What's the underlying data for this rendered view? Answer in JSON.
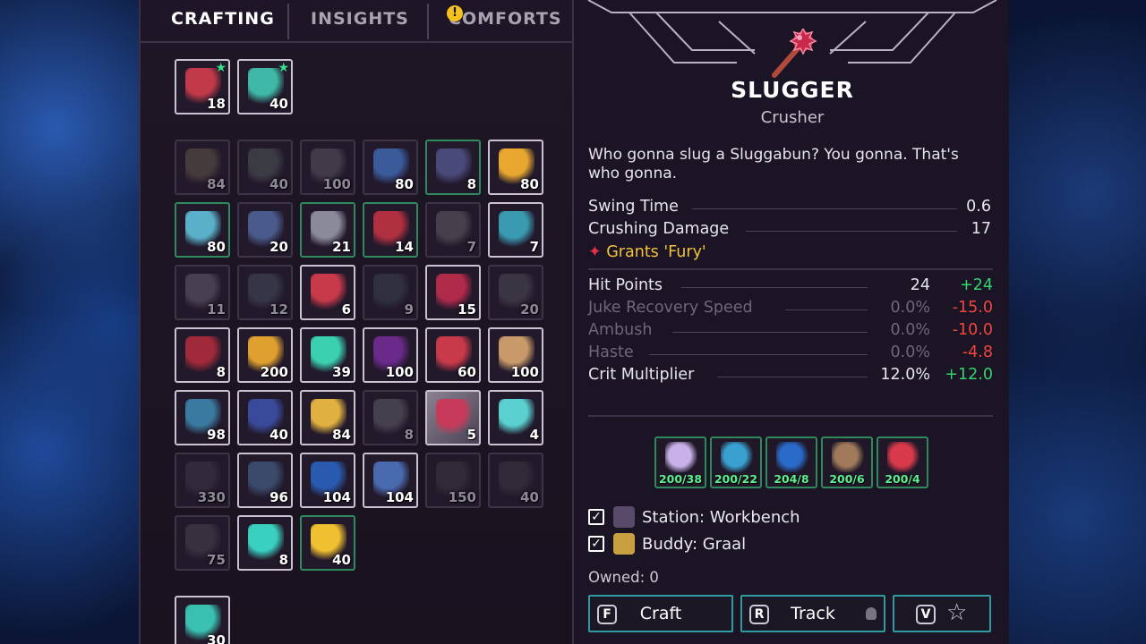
{
  "tabs": [
    {
      "label": "CRAFTING",
      "active": true
    },
    {
      "label": "INSIGHTS",
      "active": false
    },
    {
      "label": "COMFORTS",
      "active": false,
      "alert": "!"
    }
  ],
  "favorites": [
    {
      "icon": "horned-mask-icon",
      "count": "18",
      "color": "#c23a4a"
    },
    {
      "icon": "wrapped-cloth-icon",
      "count": "40",
      "color": "#3fb8a8"
    }
  ],
  "inventory": [
    {
      "icon": "stone-block-icon",
      "count": "84",
      "color": "#8a7a5a",
      "dim": true
    },
    {
      "icon": "rocks-icon",
      "count": "40",
      "color": "#6a7a74",
      "dim": true
    },
    {
      "icon": "slate-icon",
      "count": "100",
      "color": "#7a7880",
      "dim": true
    },
    {
      "icon": "feathers-icon",
      "count": "80",
      "color": "#3a5a9a"
    },
    {
      "icon": "metal-plate-icon",
      "count": "8",
      "color": "#4a4a7a",
      "border": "green"
    },
    {
      "icon": "honey-jar-icon",
      "count": "80",
      "color": "#e8a830",
      "border": "lit"
    },
    {
      "icon": "potion-bottle-icon",
      "count": "80",
      "color": "#5ab0c8",
      "border": "green"
    },
    {
      "icon": "torch-staff-icon",
      "count": "20",
      "color": "#4a5a8a"
    },
    {
      "icon": "cauldron-icon",
      "count": "21",
      "color": "#8a8a9a",
      "border": "green"
    },
    {
      "icon": "alchemy-stand-icon",
      "count": "14",
      "color": "#b03040",
      "border": "green"
    },
    {
      "icon": "hammer-icon",
      "count": "7",
      "color": "#8a8a8a",
      "dim": true
    },
    {
      "icon": "hanging-charm-icon",
      "count": "7",
      "color": "#3a9ab0",
      "border": "lit"
    },
    {
      "icon": "robot-helmet-icon",
      "count": "11",
      "color": "#8a8a9a",
      "dim": true
    },
    {
      "icon": "boot-icon",
      "count": "12",
      "color": "#5a6a7a",
      "dim": true
    },
    {
      "icon": "sleeve-icon",
      "count": "6",
      "color": "#c83a4a",
      "border": "lit"
    },
    {
      "icon": "leggings-icon",
      "count": "9",
      "color": "#4a5a6a",
      "dim": true
    },
    {
      "icon": "red-armor-icon",
      "count": "15",
      "color": "#b02a4a",
      "border": "lit"
    },
    {
      "icon": "greaves-icon",
      "count": "20",
      "color": "#6a6a70",
      "dim": true
    },
    {
      "icon": "red-beast-icon",
      "count": "8",
      "color": "#a02a3a",
      "border": "lit"
    },
    {
      "icon": "gold-bundle-icon",
      "count": "200",
      "color": "#e0a030",
      "border": "lit"
    },
    {
      "icon": "drone-icon",
      "count": "39",
      "color": "#3ad0b0",
      "border": "lit"
    },
    {
      "icon": "purple-orb-icon",
      "count": "100",
      "color": "#6a2a8a",
      "border": "lit"
    },
    {
      "icon": "spotted-egg-icon",
      "count": "60",
      "color": "#c83a4a",
      "border": "lit"
    },
    {
      "icon": "pawprint-icon",
      "count": "100",
      "color": "#c89a6a",
      "border": "lit"
    },
    {
      "icon": "wreath-icon",
      "count": "98",
      "color": "#3a7aa0",
      "border": "lit"
    },
    {
      "icon": "spear-icon",
      "count": "40",
      "color": "#3a4a9a",
      "border": "lit"
    },
    {
      "icon": "golden-spear-icon",
      "count": "84",
      "color": "#e0b040",
      "border": "lit"
    },
    {
      "icon": "axe-icon",
      "count": "8",
      "color": "#8a8a90",
      "dim": true
    },
    {
      "icon": "slugger-icon",
      "count": "5",
      "color": "#c83a5a",
      "border": "lit",
      "selected": true
    },
    {
      "icon": "crystal-sword-icon",
      "count": "4",
      "color": "#5ad0d0",
      "border": "lit"
    },
    {
      "icon": "floor-tile-icon",
      "count": "330",
      "color": "#4a4a58",
      "dim": true
    },
    {
      "icon": "plank-floor-icon",
      "count": "96",
      "color": "#3a4a6a",
      "border": "lit"
    },
    {
      "icon": "blue-rug-icon",
      "count": "104",
      "color": "#2a5ab0",
      "border": "lit"
    },
    {
      "icon": "blue-tile-icon",
      "count": "104",
      "color": "#4a6ab0",
      "border": "lit"
    },
    {
      "icon": "door-panel-icon",
      "count": "150",
      "color": "#4a4a52",
      "dim": true
    },
    {
      "icon": "door-panel-2-icon",
      "count": "40",
      "color": "#4a4a52",
      "dim": true
    },
    {
      "icon": "pillar-icon",
      "count": "75",
      "color": "#5a5a64",
      "dim": true
    },
    {
      "icon": "gem-chunk-icon",
      "count": "8",
      "color": "#3ad0c0",
      "border": "lit"
    },
    {
      "icon": "flame-lamp-icon",
      "count": "40",
      "color": "#f0c030",
      "border": "green"
    },
    {
      "icon": "fishbone-icon",
      "count": "30",
      "color": "#3ac0b0",
      "border": "lit"
    }
  ],
  "item": {
    "name": "SLUGGER",
    "type": "Crusher",
    "description": "Who gonna slug a Sluggabun? You gonna. That's who gonna.",
    "base_stats": [
      {
        "label": "Swing Time",
        "value": "0.6"
      },
      {
        "label": "Crushing Damage",
        "value": "17"
      }
    ],
    "grant": "Grants 'Fury'",
    "compare_stats": [
      {
        "label": "Hit Points",
        "value": "24",
        "delta": "+24",
        "sign": "pos",
        "active": true
      },
      {
        "label": "Juke Recovery Speed",
        "value": "0.0%",
        "delta": "-15.0",
        "sign": "neg",
        "active": false
      },
      {
        "label": "Ambush",
        "value": "0.0%",
        "delta": "-10.0",
        "sign": "neg",
        "active": false
      },
      {
        "label": "Haste",
        "value": "0.0%",
        "delta": "-4.8",
        "sign": "neg",
        "active": false
      },
      {
        "label": "Crit Multiplier",
        "value": "12.0%",
        "delta": "+12.0",
        "sign": "pos",
        "active": true
      }
    ],
    "materials": [
      {
        "icon": "spiky-orb-icon",
        "count": "200/38",
        "color": "#c8b0e8"
      },
      {
        "icon": "clam-shell-icon",
        "count": "200/22",
        "color": "#3aa0d0"
      },
      {
        "icon": "blue-claw-icon",
        "count": "204/8",
        "color": "#2a6ac8"
      },
      {
        "icon": "brown-rock-icon",
        "count": "200/6",
        "color": "#a07a5a"
      },
      {
        "icon": "red-tongue-icon",
        "count": "200/4",
        "color": "#d83a4a"
      }
    ],
    "requirements": [
      {
        "label": "Station: Workbench",
        "checked": true,
        "icon": "workbench-icon",
        "color": "#5a4a6a"
      },
      {
        "label": "Buddy: Graal",
        "checked": true,
        "icon": "graal-buddy-icon",
        "color": "#c8a040"
      }
    ],
    "owned": "Owned: 0"
  },
  "actions": {
    "craft_key": "F",
    "craft_label": "Craft",
    "track_key": "R",
    "track_label": "Track",
    "fav_key": "V"
  },
  "colors": {
    "panel_bg": "#1a1322",
    "positive": "#33d46d",
    "negative": "#f0463e",
    "grant": "#f2c23a",
    "button_border": "#2f9aa0"
  }
}
